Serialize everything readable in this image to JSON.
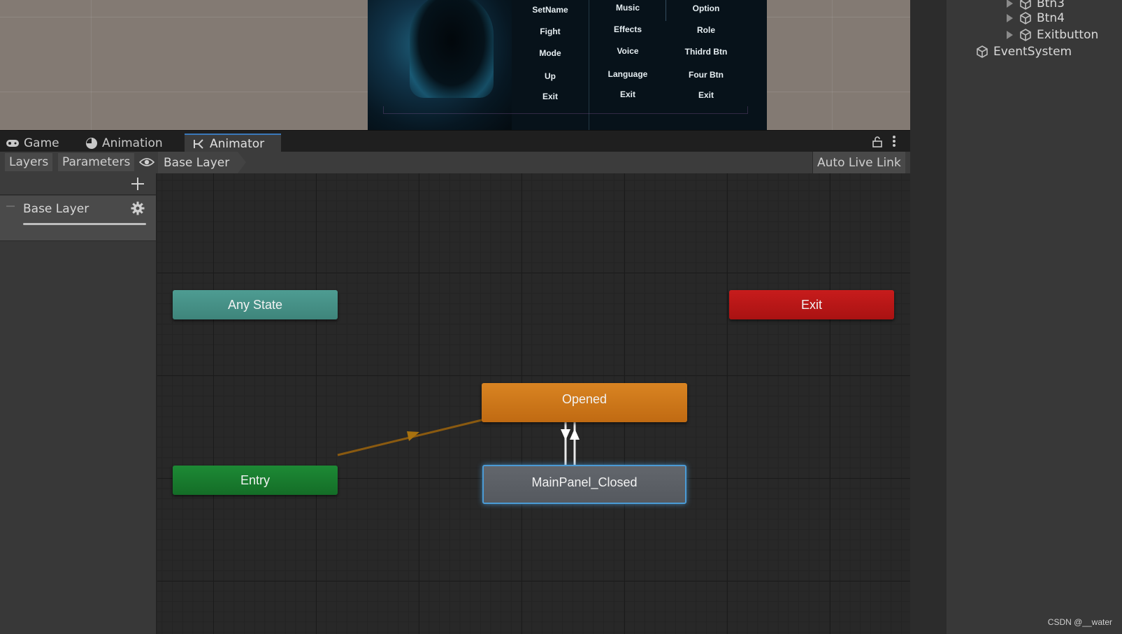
{
  "game_menu": {
    "col1": [
      "SetName",
      "Fight",
      "Mode",
      "Up",
      "Exit"
    ],
    "col2": [
      "Music",
      "Effects",
      "Voice",
      "Language",
      "Exit"
    ],
    "col3": [
      "Option",
      "Role",
      "Thidrd Btn",
      "Four Btn",
      "Exit"
    ]
  },
  "hierarchy": {
    "items": [
      {
        "label": "Btn3",
        "expandable": true
      },
      {
        "label": "Btn4",
        "expandable": true
      },
      {
        "label": "Exitbutton",
        "expandable": true
      },
      {
        "label": "EventSystem",
        "expandable": false
      }
    ]
  },
  "tabs": [
    {
      "label": "Game",
      "icon": "gamepad-icon",
      "active": false
    },
    {
      "label": "Animation",
      "icon": "clock-icon",
      "active": false
    },
    {
      "label": "Animator",
      "icon": "animator-icon",
      "active": true
    }
  ],
  "toolbar": {
    "layers_label": "Layers",
    "parameters_label": "Parameters",
    "breadcrumb": "Base Layer",
    "auto_live_link": "Auto Live Link"
  },
  "layers": [
    {
      "name": "Base Layer"
    }
  ],
  "states": {
    "any_state": "Any State",
    "exit": "Exit",
    "entry": "Entry",
    "opened": "Opened",
    "closed": "MainPanel_Closed"
  },
  "watermark": "CSDN @__water",
  "colors": {
    "any_state": "#4a958b",
    "exit": "#b81818",
    "entry": "#18802f",
    "opened": "#cf7a1b",
    "closed": "#5c6066",
    "selection": "#4b9bd6",
    "transition": "#8a5a10",
    "active_tab_accent": "#3a79bb"
  }
}
